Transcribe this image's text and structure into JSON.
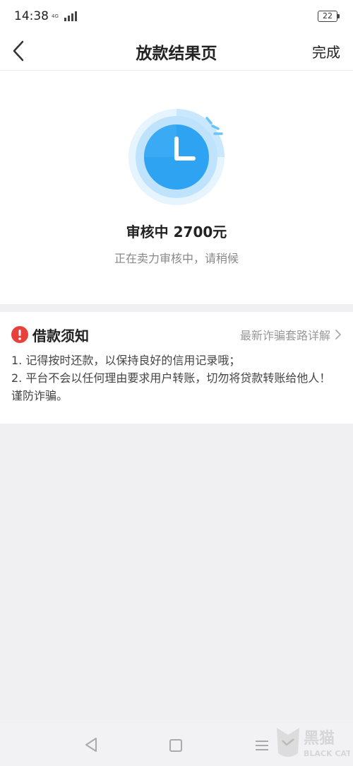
{
  "status_bar": {
    "time": "14:38",
    "network": "4G",
    "battery": "22"
  },
  "nav": {
    "title": "放款结果页",
    "done": "完成",
    "back_icon": "chevron-left-icon"
  },
  "result": {
    "icon": "clock-icon",
    "title": "审核中 2700元",
    "subtitle": "正在卖力审核中，请稍候",
    "accent": "#2ea3f2"
  },
  "notice": {
    "icon": "warning-icon",
    "icon_color": "#e8413b",
    "title": "借款须知",
    "link": "最新诈骗套路详解",
    "items": [
      "1. 记得按时还款，以保持良好的信用记录哦；",
      "2. 平台不会以任何理由要求用户转账，切勿将贷款转账给他人！谨防诈骗。"
    ]
  },
  "watermark": {
    "cn": "黑猫",
    "en": "BLACK CAT"
  }
}
